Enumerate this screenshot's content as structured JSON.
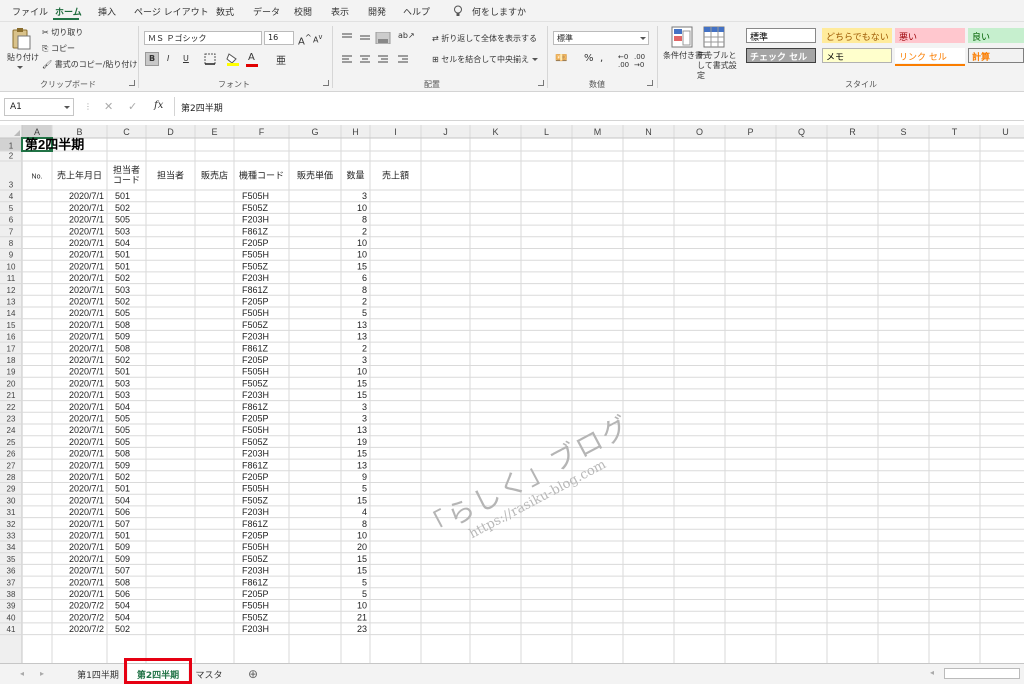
{
  "menu": {
    "items": [
      "ファイル",
      "ホーム",
      "挿入",
      "ページ レイアウト",
      "数式",
      "データ",
      "校閲",
      "表示",
      "開発",
      "ヘルプ"
    ],
    "tell_me": "何をしますか",
    "active": "ホーム"
  },
  "ribbon": {
    "clipboard": {
      "paste": "貼り付け",
      "cut": "切り取り",
      "copy": "コピー",
      "format_painter": "書式のコピー/貼り付け",
      "title": "クリップボード"
    },
    "font": {
      "name": "ＭＳ Ｐゴシック",
      "size": "16",
      "bold": "B",
      "italic": "I",
      "underline": "U",
      "title": "フォント"
    },
    "alignment": {
      "wrap": "折り返して全体を表示する",
      "merge": "セルを結合して中央揃え",
      "title": "配置"
    },
    "number": {
      "format": "標準",
      "percent": "%",
      "title": "数値"
    },
    "styles": {
      "conditional": "条件付き書式",
      "table": "テーブルとして書式設定",
      "title": "スタイル",
      "cells": [
        {
          "label": "標準",
          "bg": "#ffffff",
          "fg": "#000000",
          "border": "#888888"
        },
        {
          "label": "どちらでもない",
          "bg": "#ffeb9c",
          "fg": "#9c5700",
          "border": "#ffeb9c"
        },
        {
          "label": "悪い",
          "bg": "#ffc7ce",
          "fg": "#9c0006",
          "border": "#ffc7ce"
        },
        {
          "label": "良い",
          "bg": "#c6efce",
          "fg": "#006100",
          "border": "#c6efce"
        },
        {
          "label": "チェック セル",
          "bg": "#a5a5a5",
          "fg": "#ffffff",
          "border": "#3f3f3f"
        },
        {
          "label": "メモ",
          "bg": "#ffffcc",
          "fg": "#000000",
          "border": "#b2b2b2"
        },
        {
          "label": "リンク セル",
          "bg": "#ffffff",
          "fg": "#fa7d00",
          "border": "#ffffff"
        },
        {
          "label": "計算",
          "bg": "#f2f2f2",
          "fg": "#fa7d00",
          "border": "#7f7f7f"
        }
      ]
    }
  },
  "formula_bar": {
    "name_box": "A1",
    "fx": "fx",
    "content": "第2四半期"
  },
  "columns": [
    "A",
    "B",
    "C",
    "D",
    "E",
    "F",
    "G",
    "H",
    "I",
    "J",
    "K",
    "L",
    "M",
    "N",
    "O",
    "P",
    "Q",
    "R",
    "S",
    "T",
    "U"
  ],
  "sheet": {
    "title": "第2四半期",
    "headers": [
      "No.",
      "売上年月日",
      "担当者\nコード",
      "担当者",
      "販売店",
      "機種コード",
      "販売単価",
      "数量",
      "売上額"
    ],
    "rows": [
      [
        "2020/7/1",
        "501",
        "F505H",
        "3"
      ],
      [
        "2020/7/1",
        "502",
        "F505Z",
        "10"
      ],
      [
        "2020/7/1",
        "505",
        "F203H",
        "8"
      ],
      [
        "2020/7/1",
        "503",
        "F861Z",
        "2"
      ],
      [
        "2020/7/1",
        "504",
        "F205P",
        "10"
      ],
      [
        "2020/7/1",
        "501",
        "F505H",
        "10"
      ],
      [
        "2020/7/1",
        "501",
        "F505Z",
        "15"
      ],
      [
        "2020/7/1",
        "502",
        "F203H",
        "6"
      ],
      [
        "2020/7/1",
        "503",
        "F861Z",
        "8"
      ],
      [
        "2020/7/1",
        "502",
        "F205P",
        "2"
      ],
      [
        "2020/7/1",
        "505",
        "F505H",
        "5"
      ],
      [
        "2020/7/1",
        "508",
        "F505Z",
        "13"
      ],
      [
        "2020/7/1",
        "509",
        "F203H",
        "13"
      ],
      [
        "2020/7/1",
        "508",
        "F861Z",
        "2"
      ],
      [
        "2020/7/1",
        "502",
        "F205P",
        "3"
      ],
      [
        "2020/7/1",
        "501",
        "F505H",
        "10"
      ],
      [
        "2020/7/1",
        "503",
        "F505Z",
        "15"
      ],
      [
        "2020/7/1",
        "503",
        "F203H",
        "15"
      ],
      [
        "2020/7/1",
        "504",
        "F861Z",
        "3"
      ],
      [
        "2020/7/1",
        "505",
        "F205P",
        "3"
      ],
      [
        "2020/7/1",
        "505",
        "F505H",
        "13"
      ],
      [
        "2020/7/1",
        "505",
        "F505Z",
        "19"
      ],
      [
        "2020/7/1",
        "508",
        "F203H",
        "15"
      ],
      [
        "2020/7/1",
        "509",
        "F861Z",
        "13"
      ],
      [
        "2020/7/1",
        "502",
        "F205P",
        "9"
      ],
      [
        "2020/7/1",
        "501",
        "F505H",
        "5"
      ],
      [
        "2020/7/1",
        "504",
        "F505Z",
        "15"
      ],
      [
        "2020/7/1",
        "506",
        "F203H",
        "4"
      ],
      [
        "2020/7/1",
        "507",
        "F861Z",
        "8"
      ],
      [
        "2020/7/1",
        "501",
        "F205P",
        "10"
      ],
      [
        "2020/7/1",
        "509",
        "F505H",
        "20"
      ],
      [
        "2020/7/1",
        "509",
        "F505Z",
        "15"
      ],
      [
        "2020/7/1",
        "507",
        "F203H",
        "15"
      ],
      [
        "2020/7/1",
        "508",
        "F861Z",
        "5"
      ],
      [
        "2020/7/1",
        "506",
        "F205P",
        "5"
      ],
      [
        "2020/7/2",
        "504",
        "F505H",
        "10"
      ],
      [
        "2020/7/2",
        "504",
        "F505Z",
        "21"
      ],
      [
        "2020/7/2",
        "502",
        "F203H",
        "23"
      ]
    ]
  },
  "watermark": {
    "main": "「らしく」ブログ",
    "url": "https://rasiku-blog.com"
  },
  "tabs": [
    "第1四半期",
    "第2四半期",
    "マスタ"
  ],
  "active_tab": "第2四半期",
  "add_sheet": "⊕",
  "nav_prev": "◂",
  "nav_next": "▸",
  "highlight_color": "#e60012"
}
